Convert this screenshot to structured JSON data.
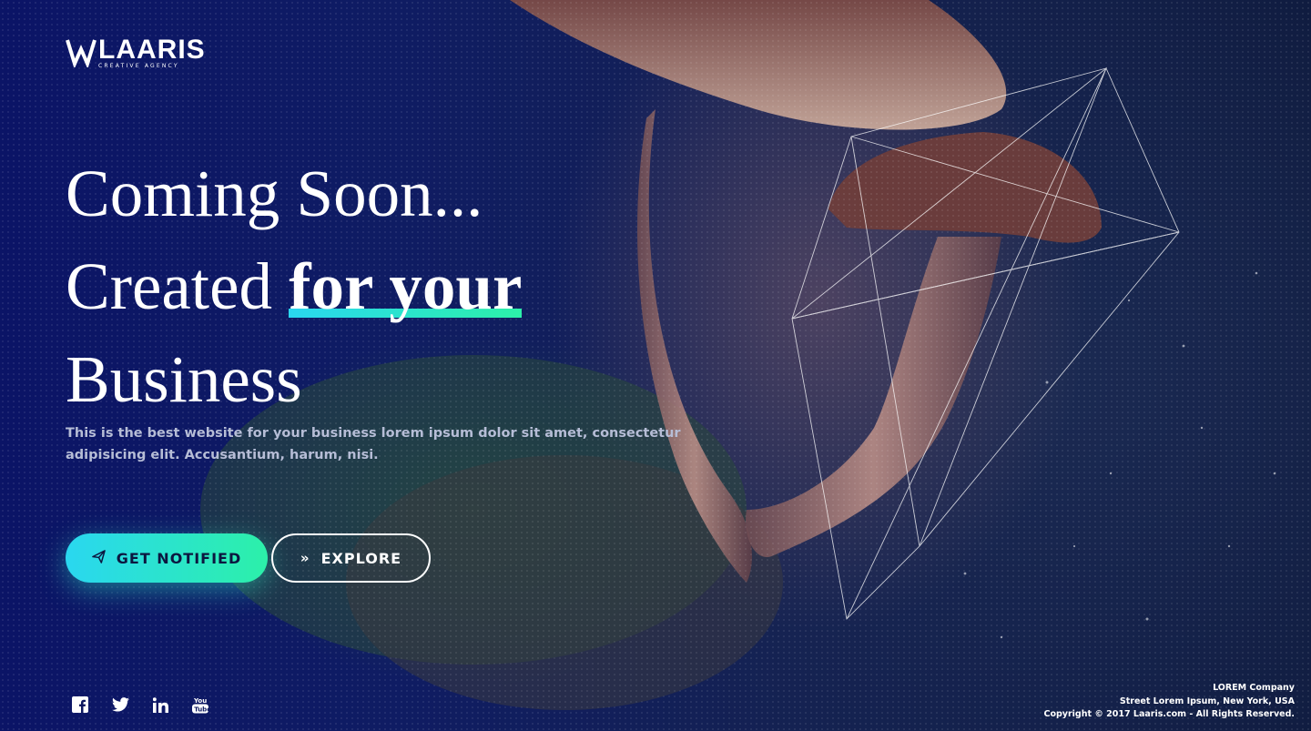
{
  "brand": {
    "name": "LAARIS",
    "tagline": "CREATIVE AGENCY"
  },
  "hero": {
    "line1": "Coming Soon...",
    "line2_prefix": "Created ",
    "line2_highlight": "for your",
    "line3": "Business",
    "description": "This is the best website for your business lorem ipsum dolor sit amet, consectetur adipisicing elit. Accusantium, harum, nisi."
  },
  "buttons": {
    "notify_label": "GET NOTIFIED",
    "explore_label": "EXPLORE",
    "notify_icon": "paper-plane-icon",
    "explore_icon": "double-chevron-right-icon"
  },
  "social": [
    "facebook-icon",
    "twitter-icon",
    "linkedin-icon",
    "youtube-icon"
  ],
  "footer": {
    "company": "LOREM Company",
    "address": "Street Lorem Ipsum, New York, USA",
    "copyright": "Copyright © 2017 Laaris.com - All Rights Reserved."
  },
  "colors": {
    "accent_start": "#2ad7f0",
    "accent_end": "#2cf0a9",
    "background": "#0b1466"
  }
}
